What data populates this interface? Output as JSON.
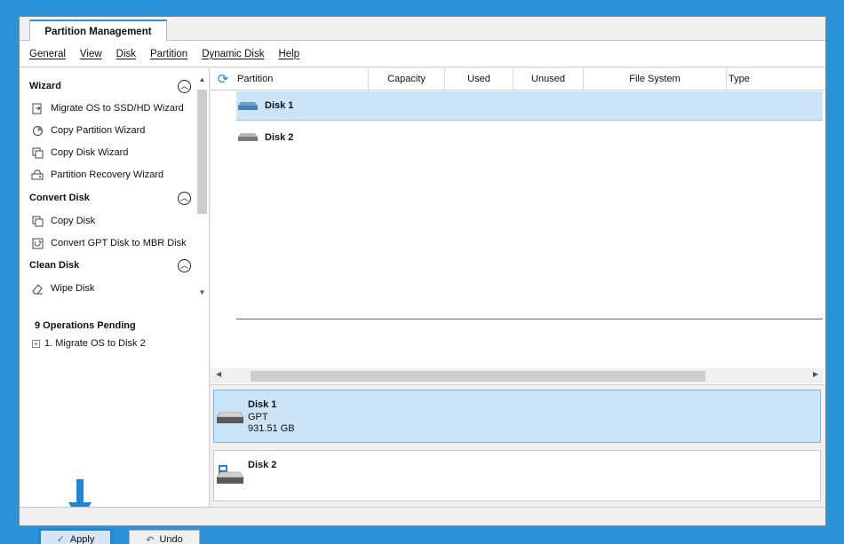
{
  "window": {
    "tab_title": "Partition Management"
  },
  "menu": [
    "General",
    "View",
    "Disk",
    "Partition",
    "Dynamic Disk",
    "Help"
  ],
  "sidebar": {
    "sections": [
      {
        "title": "Wizard",
        "items": [
          {
            "label": "Migrate OS to SSD/HD Wizard",
            "icon": "migrate-icon"
          },
          {
            "label": "Copy Partition Wizard",
            "icon": "copy-partition-icon"
          },
          {
            "label": "Copy Disk Wizard",
            "icon": "copy-disk-icon"
          },
          {
            "label": "Partition Recovery Wizard",
            "icon": "recovery-icon"
          }
        ]
      },
      {
        "title": "Convert Disk",
        "items": [
          {
            "label": "Copy Disk",
            "icon": "copy-disk-icon"
          },
          {
            "label": "Convert GPT Disk to MBR Disk",
            "icon": "convert-icon"
          }
        ]
      },
      {
        "title": "Clean Disk",
        "items": [
          {
            "label": "Wipe Disk",
            "icon": "eraser-icon"
          }
        ]
      }
    ],
    "pending": {
      "title": "9 Operations Pending",
      "items": [
        "1. Migrate OS to Disk 2"
      ]
    },
    "apply_label": "Apply",
    "undo_label": "Undo"
  },
  "table": {
    "columns": [
      "Partition",
      "Capacity",
      "Used",
      "Unused",
      "File System",
      "Type"
    ],
    "rows": [
      {
        "name": "Disk 1",
        "selected": true
      },
      {
        "name": "Disk 2",
        "selected": false
      }
    ]
  },
  "disk_map": [
    {
      "name": "Disk 1",
      "type": "GPT",
      "size": "931.51 GB",
      "selected": true
    },
    {
      "name": "Disk 2",
      "type": "",
      "size": "",
      "selected": false
    }
  ],
  "colors": {
    "accent": "#1e88d6",
    "selection": "#cce4f7",
    "background": "#2a93d8"
  }
}
